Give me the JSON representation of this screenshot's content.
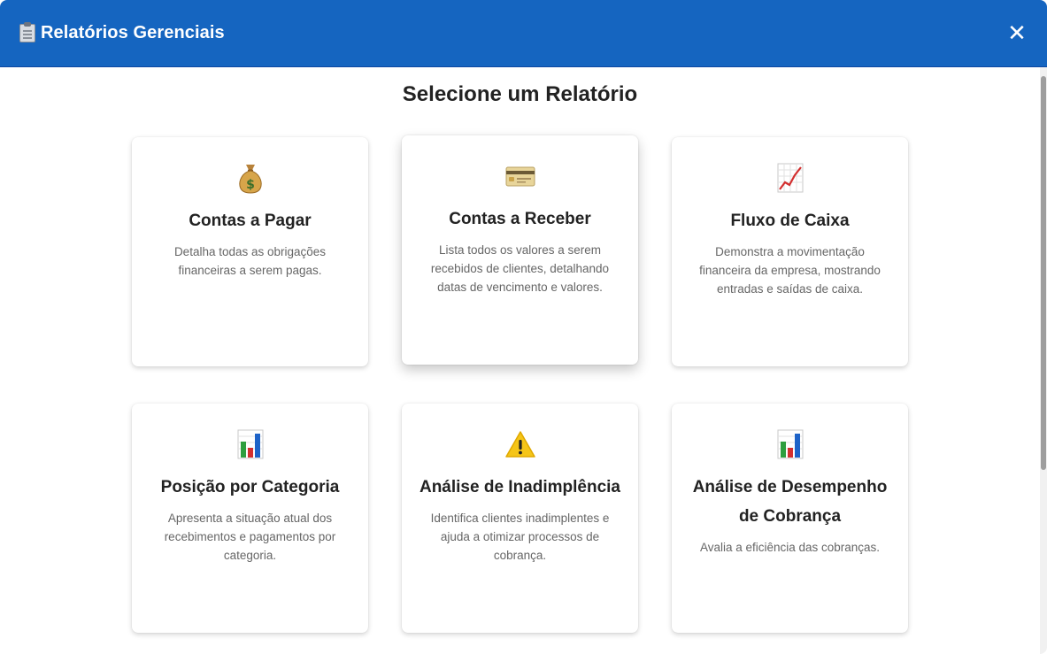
{
  "header": {
    "title": "Relatórios Gerenciais",
    "close_label": "✕",
    "color": "#1565c0"
  },
  "main": {
    "title": "Selecione um Relatório",
    "cards": [
      {
        "icon": "money-bag-icon",
        "title": "Contas a Pagar",
        "description": "Detalha todas as obrigações financeiras a serem pagas."
      },
      {
        "icon": "credit-card-icon",
        "title": "Contas a Receber",
        "description": "Lista todos os valores a serem recebidos de clientes, detalhando datas de vencimento e valores."
      },
      {
        "icon": "chart-increasing-icon",
        "title": "Fluxo de Caixa",
        "description": "Demonstra a movimentação financeira da empresa, mostrando entradas e saídas de caixa."
      },
      {
        "icon": "bar-chart-icon",
        "title": "Posição por Categoria",
        "description": "Apresenta a situação atual dos recebimentos e pagamentos por categoria."
      },
      {
        "icon": "warning-icon",
        "title": "Análise de Inadimplência",
        "description": "Identifica clientes inadimplentes e ajuda a otimizar processos de cobrança."
      },
      {
        "icon": "bar-chart-icon",
        "title": "Análise de Desempenho de Cobrança",
        "description": "Avalia a eficiência das cobranças."
      }
    ]
  }
}
